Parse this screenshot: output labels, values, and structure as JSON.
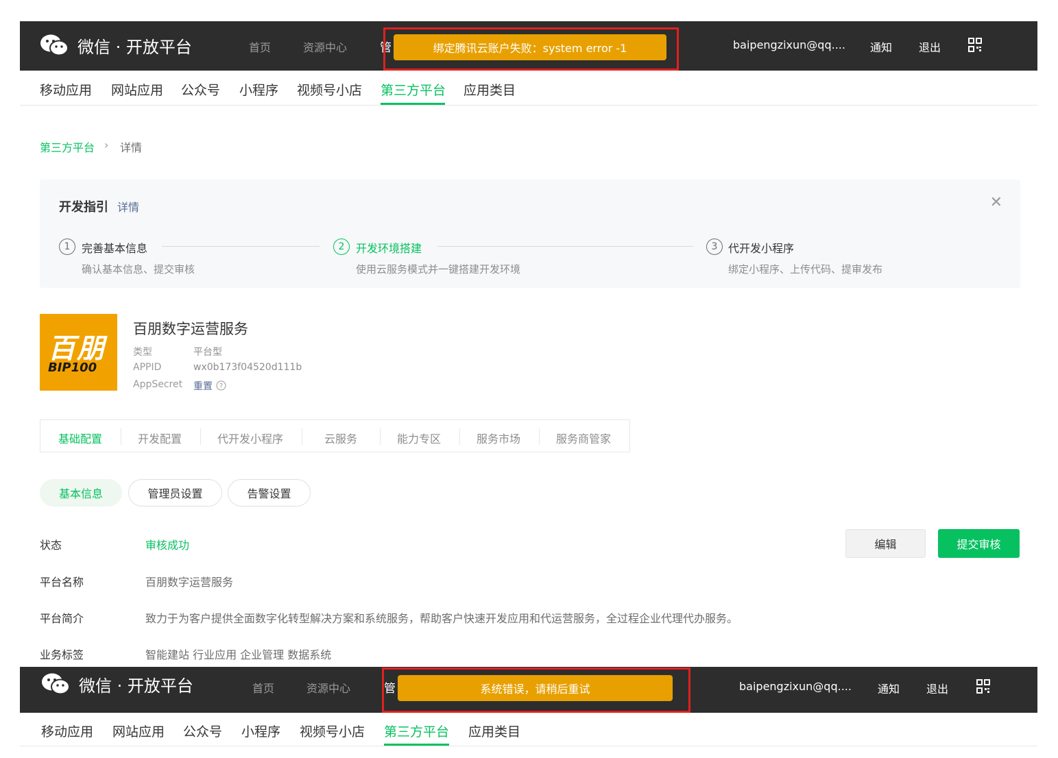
{
  "header_top": {
    "brand": "微信 · 开放平台",
    "nav": [
      "首页",
      "资源中心",
      "管"
    ],
    "toast": "绑定腾讯云账户失败：system error -1",
    "user": "baipengzixun@qq....",
    "notify": "通知",
    "logout": "退出",
    "qrcode_icon": "qrcode-icon"
  },
  "subnav_top": {
    "items": [
      "移动应用",
      "网站应用",
      "公众号",
      "小程序",
      "视频号小店",
      "第三方平台",
      "应用类目"
    ],
    "active": "第三方平台"
  },
  "breadcrumb": {
    "root": "第三方平台",
    "separator": "›",
    "current": "详情"
  },
  "guide": {
    "title": "开发指引",
    "link": "详情",
    "close_icon": "close-icon",
    "steps": [
      {
        "num": "1",
        "title": "完善基本信息",
        "desc": "确认基本信息、提交审核"
      },
      {
        "num": "2",
        "title": "开发环境搭建",
        "desc": "使用云服务模式并一键搭建开发环境"
      },
      {
        "num": "3",
        "title": "代开发小程序",
        "desc": "绑定小程序、上传代码、提审发布"
      }
    ]
  },
  "app": {
    "logo_text_cn": "百朋",
    "logo_text_en": "BIP100",
    "name": "百朋数字运营服务",
    "type_label": "类型",
    "type_value": "平台型",
    "appid_label": "APPID",
    "appid_value": "wx0b173f04520d111b",
    "secret_label": "AppSecret",
    "secret_action": "重置",
    "help_icon": "help-circle-icon"
  },
  "tabs": [
    "基础配置",
    "开发配置",
    "代开发小程序",
    "云服务",
    "能力专区",
    "服务市场",
    "服务商管家"
  ],
  "pills": [
    "基本信息",
    "管理员设置",
    "告警设置"
  ],
  "info": {
    "status_label": "状态",
    "status_value": "审核成功",
    "name_label": "平台名称",
    "name_value": "百朋数字运营服务",
    "intro_label": "平台简介",
    "intro_value": "致力于为客户提供全面数字化转型解决方案和系统服务，帮助客户快速开发应用和代运营服务，全过程企业代理代办服务。",
    "tags_label": "业务标签",
    "tags_value": "智能建站 行业应用 企业管理 数据系统",
    "edit_button": "编辑",
    "submit_button": "提交审核"
  },
  "header_bottom": {
    "brand": "微信 · 开放平台",
    "nav": [
      "首页",
      "资源中心",
      "管"
    ],
    "toast": "系统错误，请稍后重试",
    "user": "baipengzixun@qq....",
    "notify": "通知",
    "logout": "退出"
  },
  "subnav_bottom": {
    "items": [
      "移动应用",
      "网站应用",
      "公众号",
      "小程序",
      "视频号小店",
      "第三方平台",
      "应用类目"
    ],
    "active": "第三方平台"
  },
  "colors": {
    "topbar": "#2d2d2d",
    "accent": "#07c160",
    "toast": "#e8a000",
    "highlight": "#e02020",
    "logo_bg": "#f2a200"
  }
}
